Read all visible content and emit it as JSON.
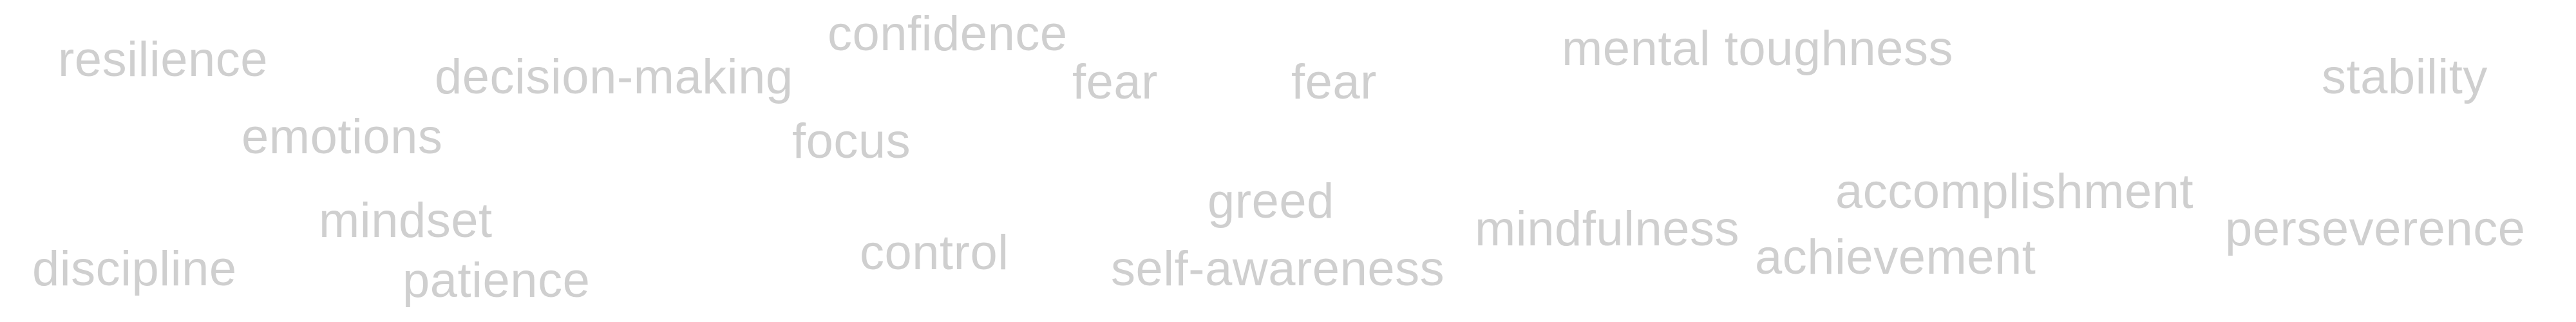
{
  "word_cloud": {
    "text_color": "#cfcfcf",
    "words": {
      "resilience": "resilience",
      "decision_making": "decision-making",
      "confidence": "confidence",
      "fear_1": "fear",
      "fear_2": "fear",
      "mental_toughness": "mental toughness",
      "stability": "stability",
      "emotions": "emotions",
      "focus": "focus",
      "greed": "greed",
      "accomplishment": "accomplishment",
      "mindset": "mindset",
      "mindfulness": "mindfulness",
      "perseverence": "perseverence",
      "control": "control",
      "discipline": "discipline",
      "self_awareness": "self-awareness",
      "achievement": "achievement",
      "patience": "patience"
    }
  }
}
